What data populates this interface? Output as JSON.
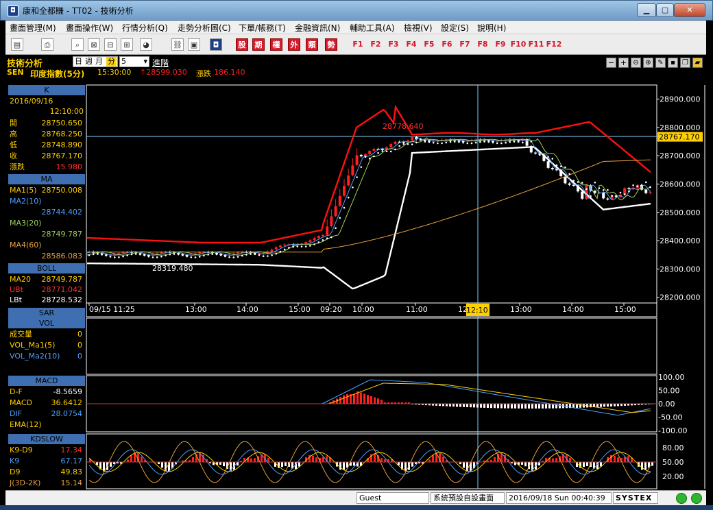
{
  "window": {
    "title": "康和全都賺 - TT02 - 技術分析"
  },
  "menu": [
    "畫面管理(M)",
    "畫面操作(W)",
    "行情分析(Q)",
    "走勢分析圖(C)",
    "下單/帳務(T)",
    "金融資訊(N)",
    "輔助工具(A)",
    "檢視(V)",
    "設定(S)",
    "說明(H)"
  ],
  "toolbar": {
    "cn_buttons": [
      "股",
      "期",
      "權",
      "外",
      "類",
      "勢"
    ],
    "fkeys": [
      "F1",
      "F2",
      "F3",
      "F4",
      "F5",
      "F6",
      "F7",
      "F8",
      "F9",
      "F10",
      "F11",
      "F12"
    ]
  },
  "header": {
    "title": "技術分析",
    "periods": [
      "日",
      "週",
      "月",
      "分"
    ],
    "interval_value": "5",
    "advanced": "進階",
    "symbol": "SEN",
    "symbol_name": "印度指數(5分)",
    "time": "15:30:00",
    "price": "↑28599.030",
    "change_label": "漲跌",
    "change": "186.140"
  },
  "k_panel": {
    "header": "K",
    "date": "2016/09/16",
    "time": "12:10:00",
    "rows": [
      [
        "開",
        "28750.650"
      ],
      [
        "高",
        "28768.250"
      ],
      [
        "低",
        "28748.890"
      ],
      [
        "收",
        "28767.170"
      ],
      [
        "漲跌",
        "15.980"
      ]
    ]
  },
  "ma_panel": {
    "header": "MA",
    "rows": [
      [
        "MA1(5)",
        "28750.008"
      ],
      [
        "MA2(10)",
        ""
      ],
      [
        "",
        "28744.402"
      ],
      [
        "MA3(20)",
        ""
      ],
      [
        "",
        "28749.787"
      ],
      [
        "MA4(60)",
        ""
      ],
      [
        "",
        "28586.083"
      ]
    ]
  },
  "boll_panel": {
    "header": "BOLL",
    "rows": [
      [
        "MA20",
        "28749.787"
      ],
      [
        "UBt",
        "28771.042"
      ],
      [
        "LBt",
        "28728.532"
      ]
    ]
  },
  "sar_panel": {
    "header": "SAR"
  },
  "vol_panel": {
    "header": "VOL",
    "rows": [
      [
        "成交量",
        "0"
      ],
      [
        "VOL_Ma1(5)",
        "0"
      ],
      [
        "VOL_Ma2(10)",
        "0"
      ]
    ]
  },
  "macd_panel": {
    "header": "MACD",
    "rows": [
      [
        "D-F",
        "-8.5659"
      ],
      [
        "MACD",
        "36.6412"
      ],
      [
        "DIF",
        "28.0754"
      ],
      [
        "EMA(12)",
        ""
      ]
    ]
  },
  "kd_panel": {
    "header": "KDSLOW",
    "rows": [
      [
        "K9-D9",
        "17.34"
      ],
      [
        "K9",
        "67.17"
      ],
      [
        "D9",
        "49.83"
      ],
      [
        "J(3D-2K)",
        "15.14"
      ]
    ]
  },
  "price_axis": [
    "28900.000",
    "28800.000",
    "28700.000",
    "28600.000",
    "28500.000",
    "28400.000",
    "28300.000",
    "28200.000"
  ],
  "current_price_label": "28767.170",
  "macd_axis": [
    "100.00",
    "50.00",
    "0.00",
    "-50.00",
    "-100.00"
  ],
  "kd_axis": [
    "80.00",
    "50.00",
    "20.00"
  ],
  "time_axis": [
    "09/15 11:25",
    "13:00",
    "14:00",
    "15:00",
    "09:20",
    "10:00",
    "11:00",
    "12:10",
    "13:00",
    "14:00",
    "15:00"
  ],
  "annotations": {
    "high": "28778.640",
    "low": "28319.480"
  },
  "status": {
    "user": "Guest",
    "layout": "系統預設自設畫面",
    "datetime": "2016/09/18 Sun 00:40:39",
    "brand": "SYSTEX"
  },
  "colors": {
    "panel_header": "#3f6fb0",
    "up": "#ff2020",
    "boll": "#ff0000",
    "white": "#ffffff"
  },
  "chart_data": {
    "type": "line",
    "title": "SEN 印度指數(5分)",
    "x": [
      "09/15 11:25",
      "13:00",
      "14:00",
      "15:00",
      "09:20",
      "10:00",
      "11:00",
      "12:10",
      "13:00",
      "14:00",
      "15:00"
    ],
    "series": [
      {
        "name": "收",
        "values": [
          28360,
          28350,
          28340,
          28380,
          28430,
          28700,
          28755,
          28760,
          28720,
          28550,
          28590
        ]
      },
      {
        "name": "UBt",
        "values": [
          28420,
          28400,
          28380,
          28440,
          28460,
          28880,
          28780,
          28780,
          28760,
          28800,
          28650
        ]
      },
      {
        "name": "LBt",
        "values": [
          28330,
          28320,
          28330,
          28320,
          28300,
          28250,
          28680,
          28730,
          28700,
          28510,
          28530
        ]
      },
      {
        "name": "MA4(60)",
        "values": [
          28360,
          28360,
          28355,
          28370,
          28390,
          28460,
          28550,
          28610,
          28650,
          28690,
          28690
        ]
      }
    ],
    "ylim": [
      28180,
      28950
    ]
  }
}
